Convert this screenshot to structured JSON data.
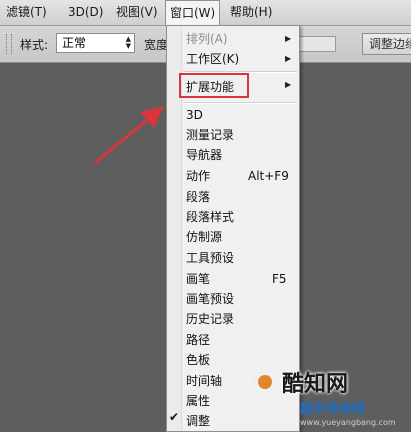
{
  "menubar": {
    "items": [
      "滤镜(T)",
      "3D(D)",
      "视图(V)",
      "窗口(W)",
      "帮助(H)"
    ],
    "active_index": 3
  },
  "options_bar": {
    "style_label": "样式:",
    "style_value": "正常",
    "width_label": "宽度",
    "adjust_button": "调整边缘"
  },
  "window_menu": {
    "top_items": [
      {
        "label": "排列(A)",
        "disabled": true,
        "has_submenu": true
      },
      {
        "label": "工作区(K)",
        "disabled": false,
        "has_submenu": true
      }
    ],
    "extension": {
      "label": "扩展功能",
      "has_submenu": true
    },
    "items": [
      {
        "label": "3D",
        "shortcut": ""
      },
      {
        "label": "测量记录",
        "shortcut": ""
      },
      {
        "label": "导航器",
        "shortcut": ""
      },
      {
        "label": "动作",
        "shortcut": "Alt+F9"
      },
      {
        "label": "段落",
        "shortcut": ""
      },
      {
        "label": "段落样式",
        "shortcut": ""
      },
      {
        "label": "仿制源",
        "shortcut": ""
      },
      {
        "label": "工具预设",
        "shortcut": ""
      },
      {
        "label": "画笔",
        "shortcut": "F5"
      },
      {
        "label": "画笔预设",
        "shortcut": ""
      },
      {
        "label": "历史记录",
        "shortcut": ""
      },
      {
        "label": "路径",
        "shortcut": ""
      },
      {
        "label": "色板",
        "shortcut": ""
      },
      {
        "label": "时间轴",
        "shortcut": ""
      },
      {
        "label": "属性",
        "shortcut": ""
      },
      {
        "label": "调整",
        "shortcut": "",
        "checked": true
      }
    ],
    "check_mark": "✔"
  },
  "watermark": {
    "text1": "酷知网",
    "text2": "超半导体网",
    "url": "www.yueyangbang.com"
  },
  "colors": {
    "highlight": "#d9363b",
    "arrow": "#d9363b",
    "watermark_orange": "#e0852b",
    "watermark_blue": "#1f6fc4"
  }
}
